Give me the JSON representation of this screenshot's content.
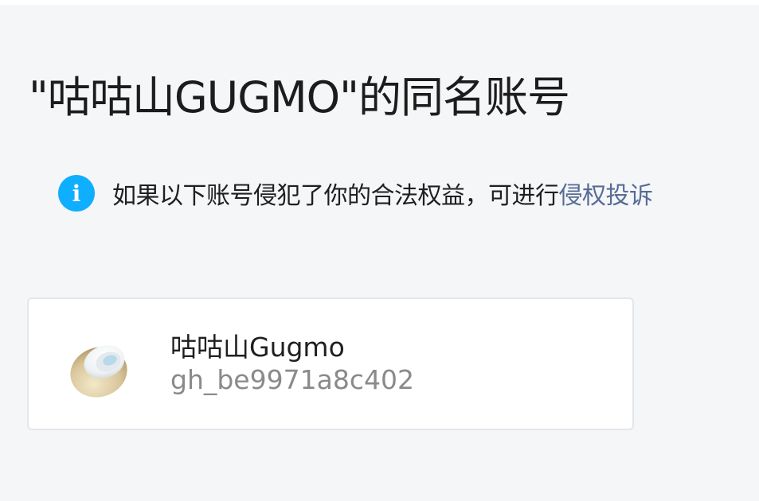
{
  "page": {
    "title": "\"咕咕山GUGMO\"的同名账号"
  },
  "notice": {
    "icon": "info-icon",
    "icon_glyph": "i",
    "icon_color": "#10aeff",
    "text": "如果以下账号侵犯了你的合法权益，可进行",
    "link_label": "侵权投诉",
    "link_color": "#576b95"
  },
  "accounts": [
    {
      "avatar": "coconut-icon",
      "name": "咕咕山Gugmo",
      "id": "gh_be9971a8c402"
    }
  ]
}
